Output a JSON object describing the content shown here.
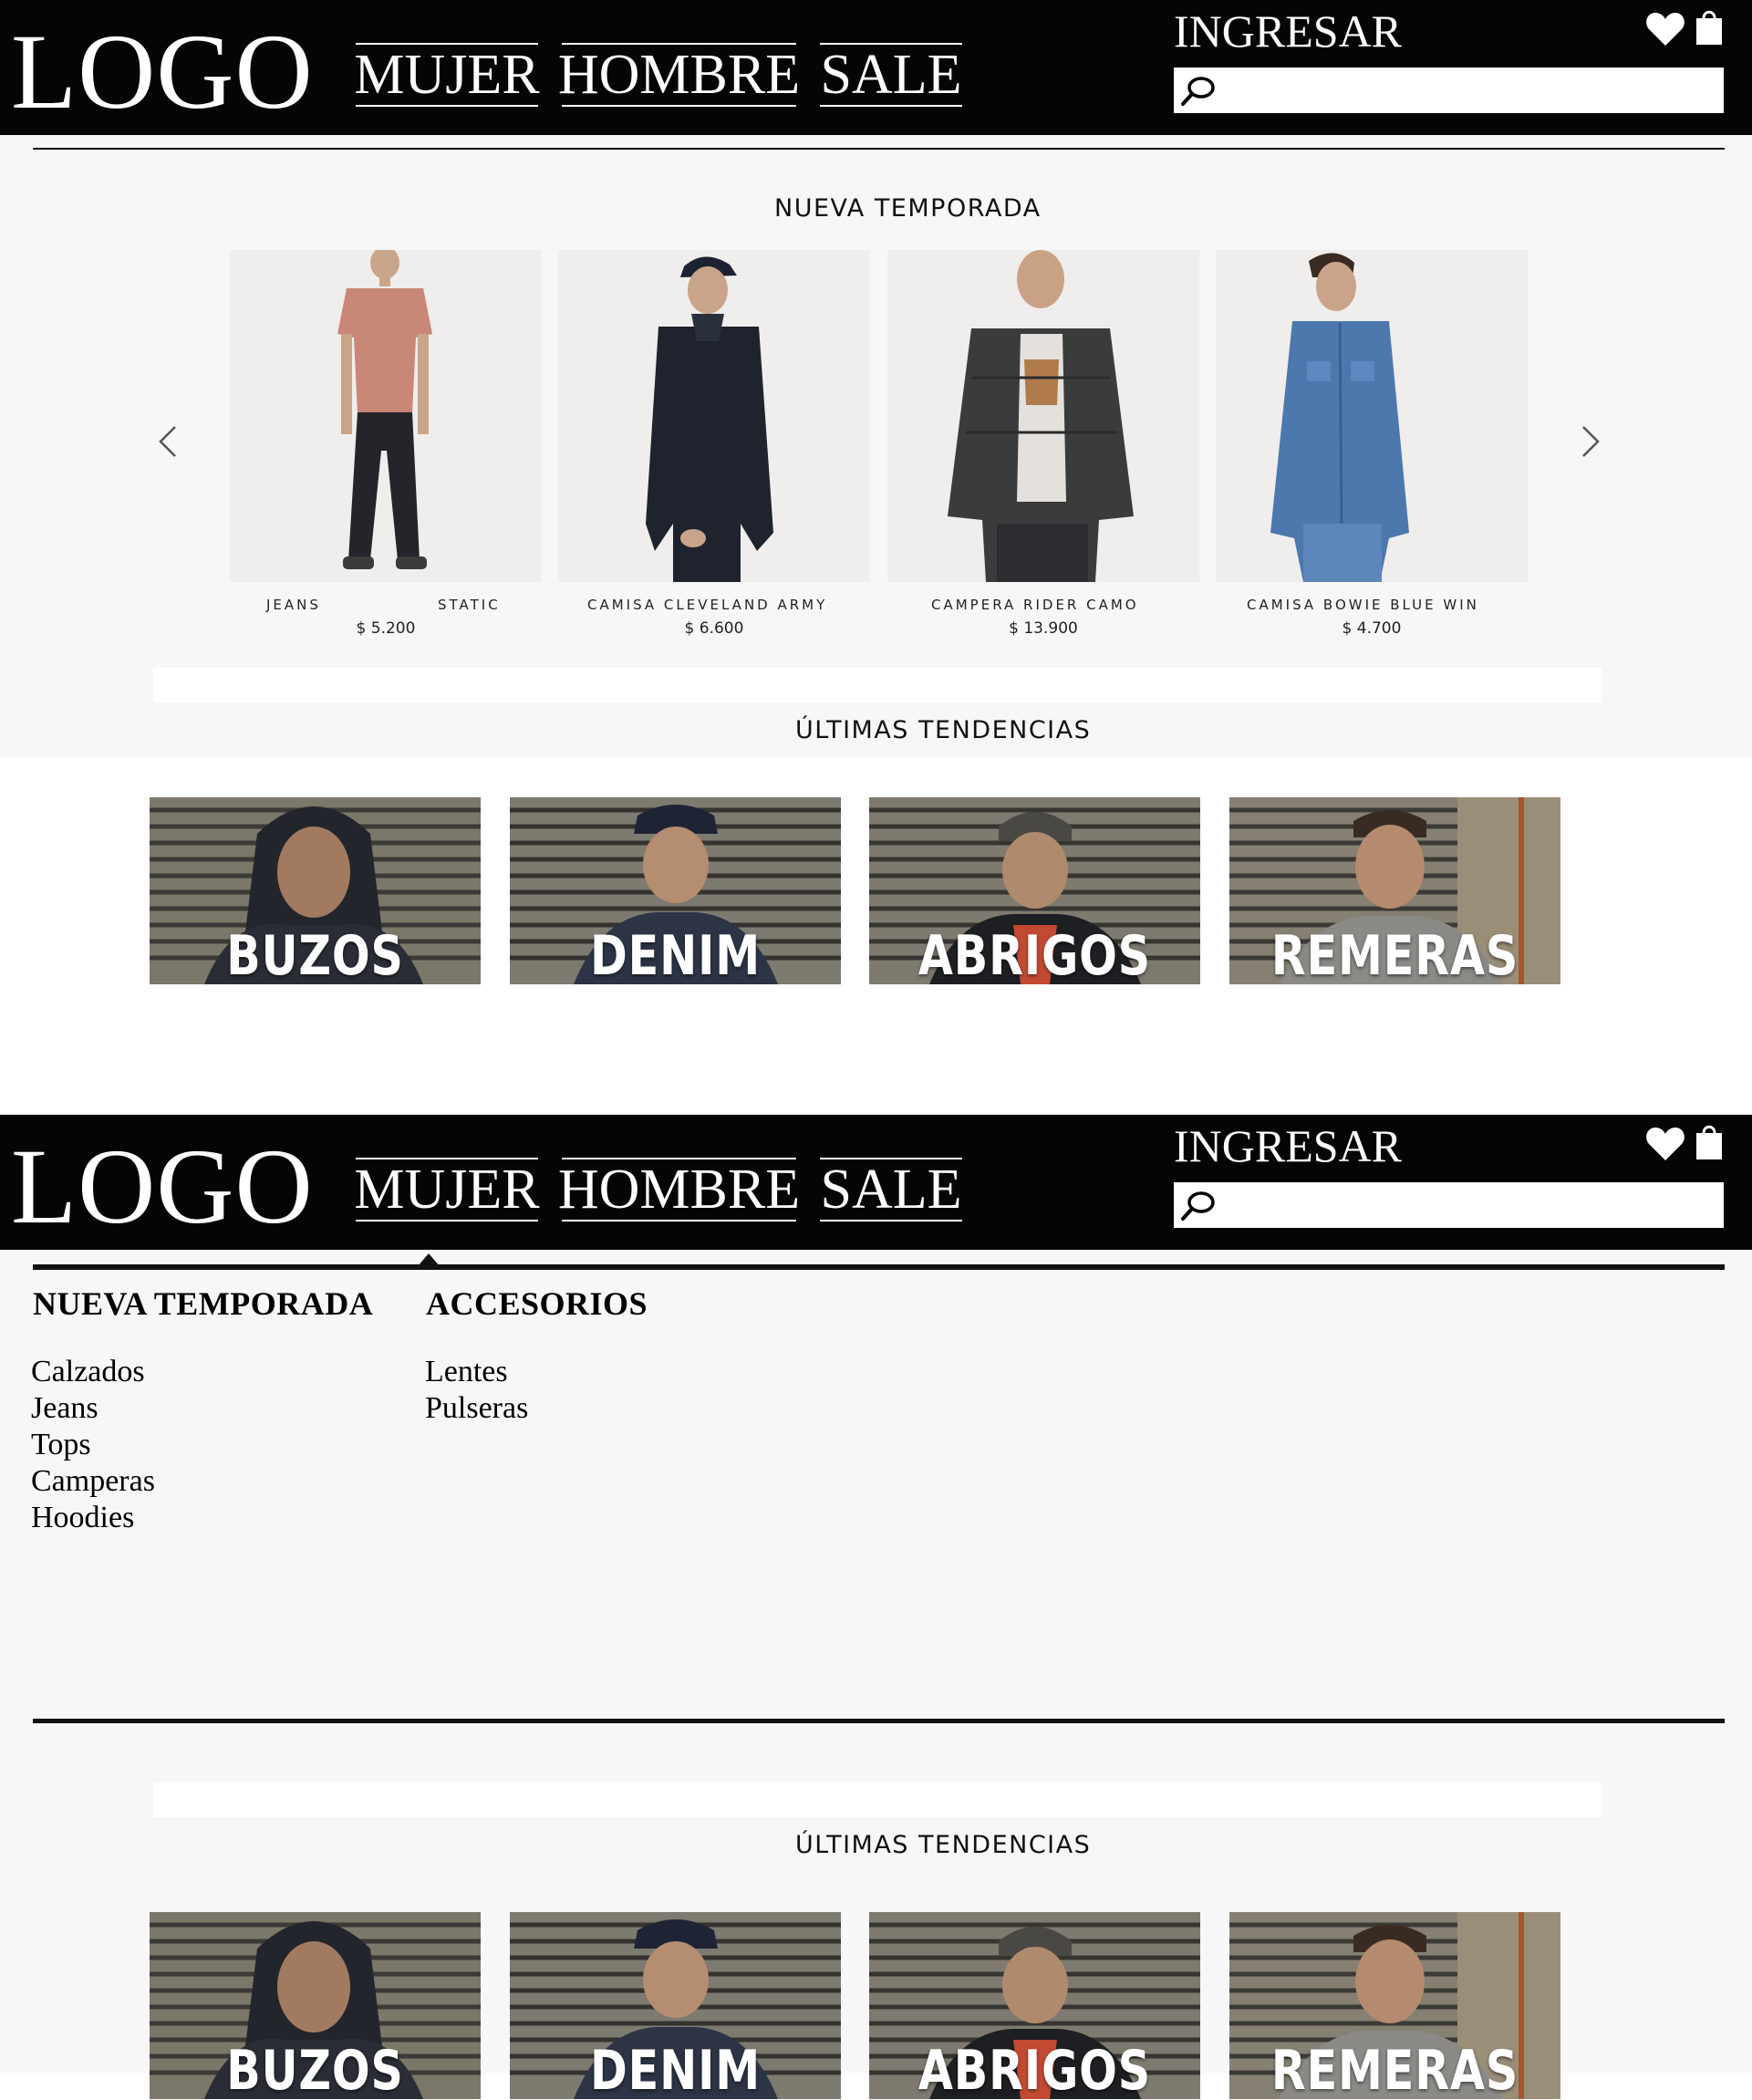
{
  "header": {
    "logo": "LOGO",
    "nav": [
      "MUJER",
      "HOMBRE",
      "SALE"
    ],
    "login": "INGRESAR",
    "search_placeholder": ""
  },
  "new_season": {
    "title": "NUEVA TEMPORADA",
    "products": [
      {
        "name_left": "JEANS",
        "name_right": "STATIC",
        "price": "$ 5.200"
      },
      {
        "name": "CAMISA CLEVELAND ARMY",
        "price": "$ 6.600"
      },
      {
        "name": "CAMPERA RIDER CAMO",
        "price": "$ 13.900"
      },
      {
        "name": "CAMISA BOWIE BLUE WIN",
        "price": "$ 4.700"
      }
    ]
  },
  "trends": {
    "title": "ÚLTIMAS TENDENCIAS",
    "categories": [
      "BUZOS",
      "DENIM",
      "ABRIGOS",
      "REMERAS"
    ]
  },
  "mega_menu": {
    "columns": [
      {
        "title": "NUEVA TEMPORADA",
        "items": [
          "Calzados",
          "Jeans",
          "Tops",
          "Camperas",
          "Hoodies"
        ]
      },
      {
        "title": "ACCESORIOS",
        "items": [
          "Lentes",
          "Pulseras"
        ]
      }
    ]
  },
  "colors": {
    "header_bg": "#050505",
    "content_bg": "#f7f7f7"
  },
  "icons": [
    "search-icon",
    "heart-icon",
    "shopping-bag-icon",
    "chevron-left-icon",
    "chevron-right-icon"
  ]
}
